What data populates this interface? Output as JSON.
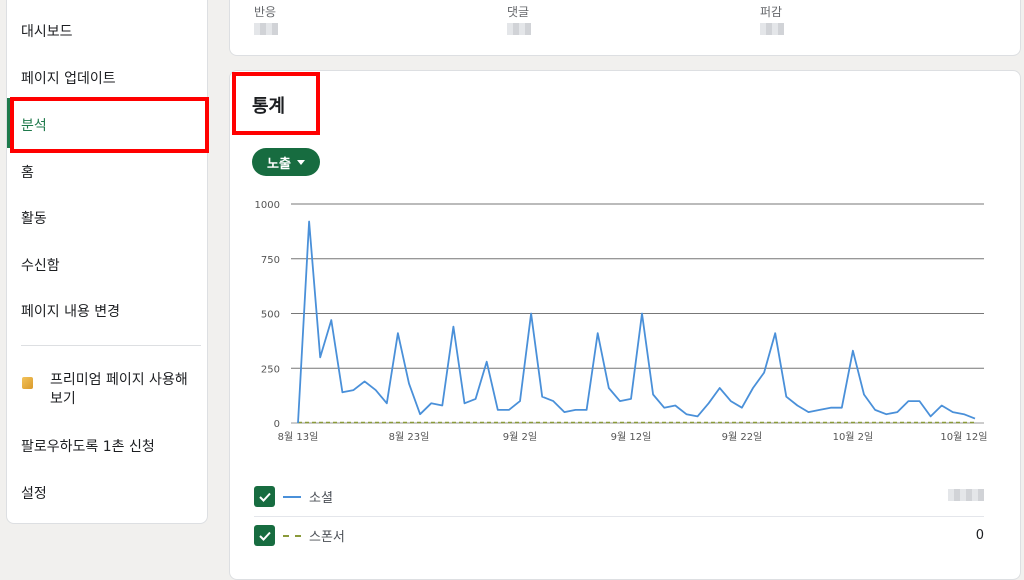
{
  "sidebar": {
    "items": [
      {
        "label": "대시보드"
      },
      {
        "label": "페이지 업데이트"
      },
      {
        "label": "분석"
      },
      {
        "label": "홈"
      },
      {
        "label": "활동"
      },
      {
        "label": "수신함"
      },
      {
        "label": "페이지 내용 변경"
      }
    ],
    "active_index": 2,
    "premium_label": "프리미엄 페이지 사용해 보기",
    "promote_label": "팔로우하도록 1촌 신청",
    "settings_label": "설정"
  },
  "stats_card": {
    "labels": [
      "반응",
      "댓글",
      "퍼감"
    ]
  },
  "analytics": {
    "title": "통계",
    "dropdown_label": "노출",
    "legend": [
      {
        "label": "소셜",
        "value": "",
        "color": "#4a90d9",
        "checked": true
      },
      {
        "label": "스폰서",
        "value": "0",
        "color": "#8a9a3a",
        "checked": true
      }
    ]
  },
  "chart_data": {
    "type": "line",
    "x_ticks": [
      "8월 13일",
      "8월 23일",
      "9월 2일",
      "9월 12일",
      "9월 22일",
      "10월 2일",
      "10월 12일"
    ],
    "y_ticks": [
      0,
      250,
      500,
      750,
      1000
    ],
    "ylim": [
      0,
      1000
    ],
    "x_start": "8월 13일",
    "grid": true,
    "series": [
      {
        "name": "소셜",
        "color": "#4a90d9",
        "values": [
          0,
          920,
          300,
          470,
          140,
          150,
          190,
          150,
          90,
          410,
          180,
          40,
          90,
          80,
          440,
          90,
          110,
          280,
          60,
          60,
          100,
          500,
          120,
          100,
          50,
          60,
          60,
          410,
          160,
          100,
          110,
          500,
          130,
          70,
          80,
          40,
          30,
          90,
          160,
          100,
          70,
          160,
          230,
          410,
          120,
          80,
          50,
          60,
          70,
          70,
          330,
          130,
          60,
          40,
          50,
          100,
          100,
          30,
          80,
          50,
          40,
          20
        ]
      },
      {
        "name": "스폰서",
        "color": "#8a9a3a",
        "dashed": true,
        "values": [
          0,
          0
        ]
      }
    ]
  }
}
